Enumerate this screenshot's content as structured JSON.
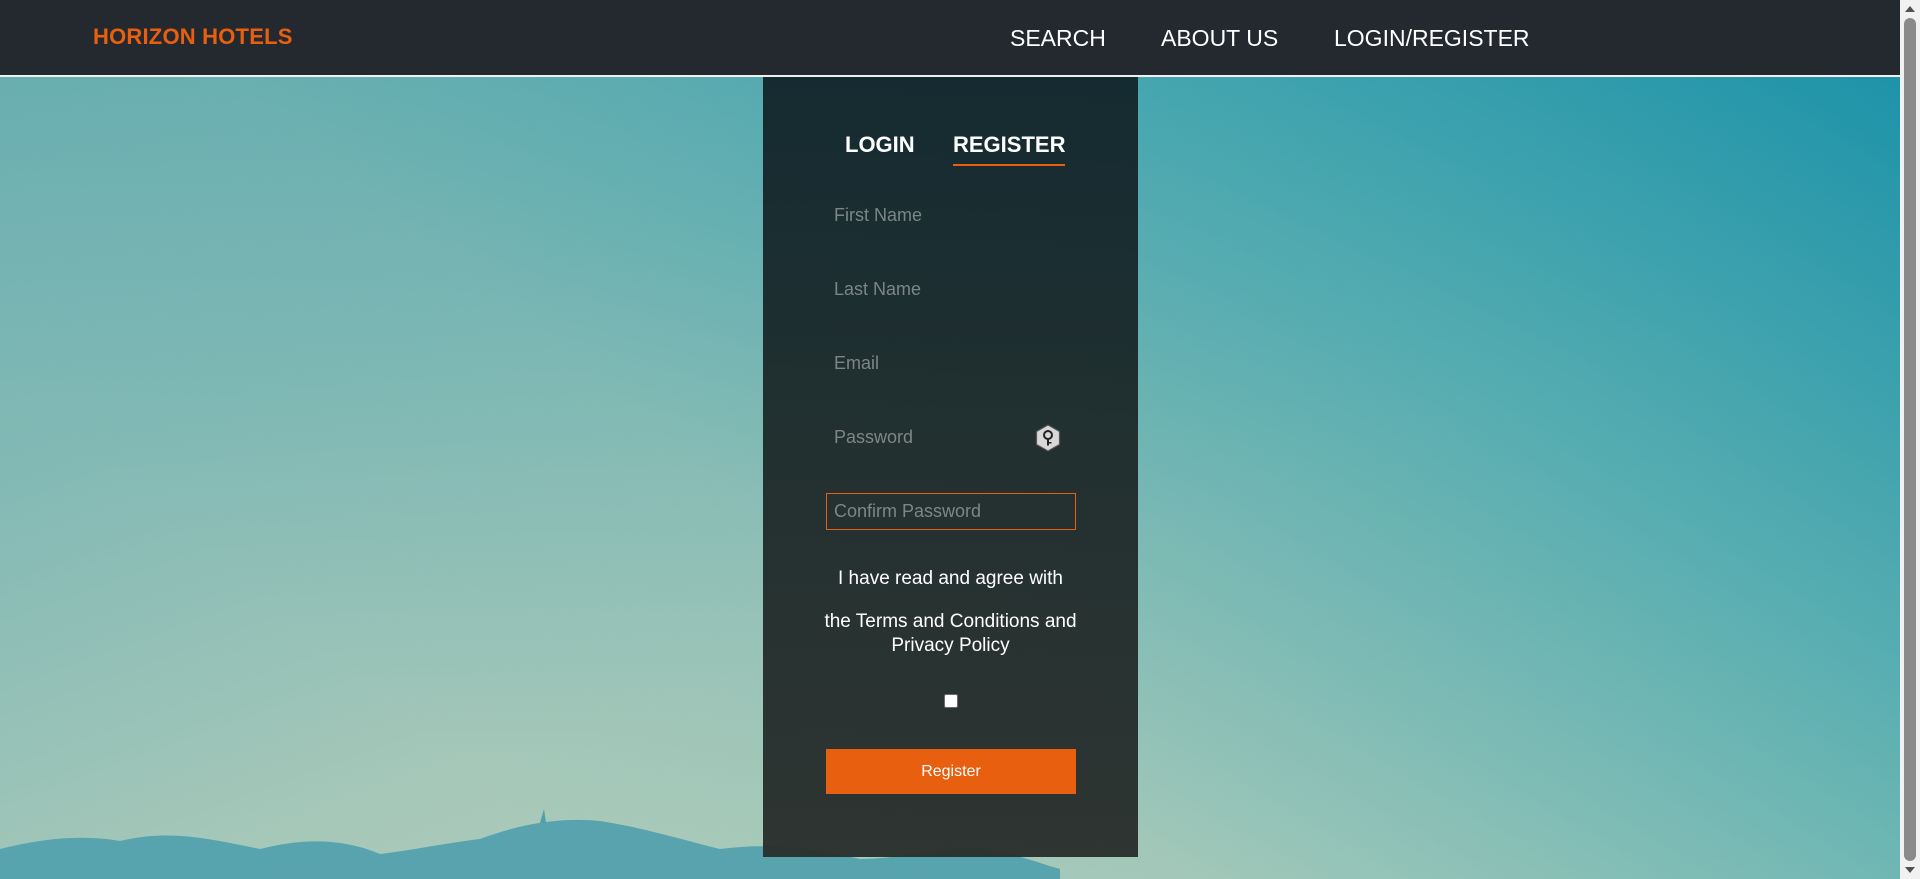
{
  "navbar": {
    "brand": "HORIZON HOTELS",
    "links": [
      {
        "label": "SEARCH"
      },
      {
        "label": "ABOUT US"
      },
      {
        "label": "LOGIN/REGISTER"
      }
    ]
  },
  "auth_panel": {
    "tabs": [
      {
        "label": "LOGIN",
        "active": false
      },
      {
        "label": "REGISTER",
        "active": true
      }
    ],
    "fields": {
      "first_name": {
        "placeholder": "First Name",
        "value": ""
      },
      "last_name": {
        "placeholder": "Last Name",
        "value": ""
      },
      "email": {
        "placeholder": "Email",
        "value": ""
      },
      "password": {
        "placeholder": "Password",
        "value": ""
      },
      "confirm_password": {
        "placeholder": "Confirm Password",
        "value": "",
        "focused": true
      }
    },
    "password_manager_icon": "key-icon",
    "terms_line1": "I have read and agree with",
    "terms_line2": "the Terms and Conditions and Privacy Policy",
    "agree_checked": false,
    "register_button": "Register"
  },
  "colors": {
    "accent": "#e8600f",
    "navbar_bg": "#24292f",
    "panel_bg": "#1f2d30"
  }
}
